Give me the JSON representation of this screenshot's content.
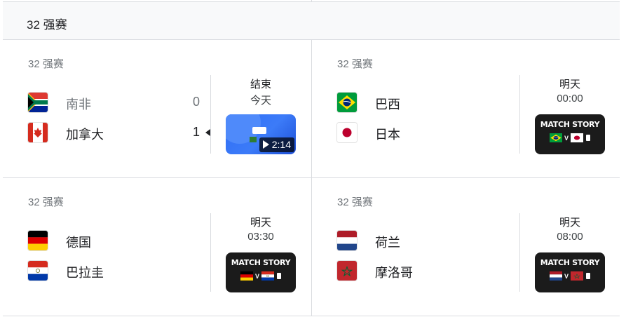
{
  "header": {
    "title": "32 强赛"
  },
  "matches": [
    {
      "stage": "32 强赛",
      "home": {
        "name": "南非",
        "flag": "south-africa-flag",
        "score": "0",
        "winner": false
      },
      "away": {
        "name": "加拿大",
        "flag": "canada-flag",
        "score": "1",
        "winner": true
      },
      "status_line1": "结束",
      "status_line2": "今天",
      "media": {
        "type": "video",
        "duration": "2:14"
      }
    },
    {
      "stage": "32 强赛",
      "home": {
        "name": "巴西",
        "flag": "brazil-flag"
      },
      "away": {
        "name": "日本",
        "flag": "japan-flag"
      },
      "status_line1": "明天",
      "status_line2": "00:00",
      "media": {
        "type": "story",
        "label": "MATCH STORY",
        "vs": "V"
      }
    },
    {
      "stage": "32 强赛",
      "home": {
        "name": "德国",
        "flag": "germany-flag"
      },
      "away": {
        "name": "巴拉圭",
        "flag": "paraguay-flag"
      },
      "status_line1": "明天",
      "status_line2": "03:30",
      "media": {
        "type": "story",
        "label": "MATCH STORY",
        "vs": "V"
      }
    },
    {
      "stage": "32 强赛",
      "home": {
        "name": "荷兰",
        "flag": "netherlands-flag"
      },
      "away": {
        "name": "摩洛哥",
        "flag": "morocco-flag"
      },
      "status_line1": "明天",
      "status_line2": "08:00",
      "media": {
        "type": "story",
        "label": "MATCH STORY",
        "vs": "V"
      }
    }
  ],
  "colors": {
    "divider": "#dadce0",
    "header_bg": "#f8f9fa",
    "muted_text": "#70757a",
    "video_blue": "#2f6ef6"
  }
}
